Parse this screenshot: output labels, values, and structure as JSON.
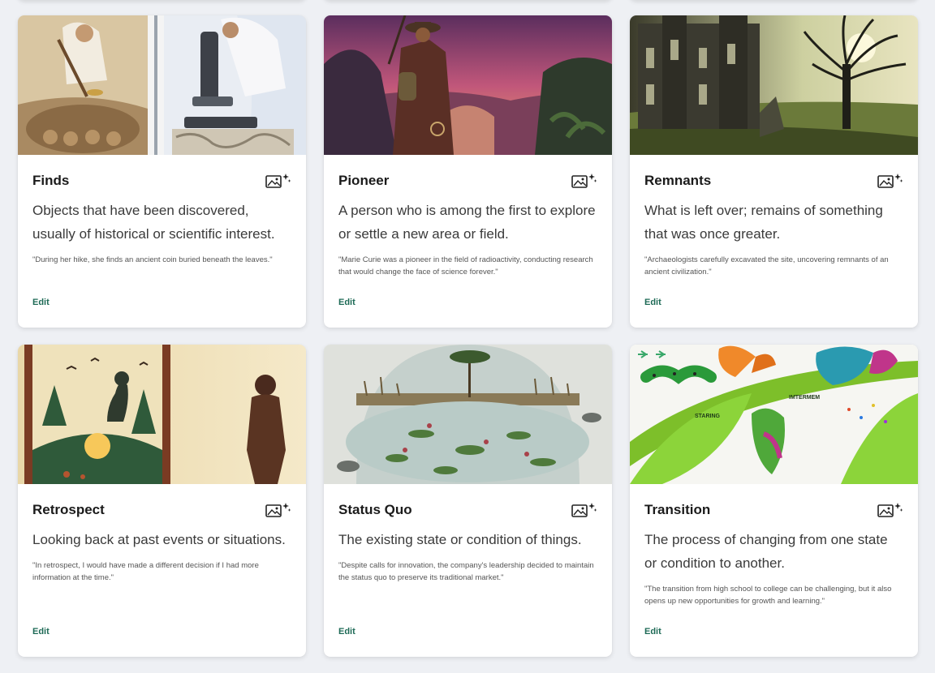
{
  "cards": [
    {
      "word": "Finds",
      "definition": "Objects that have been discovered, usually of historical or scientific interest.",
      "example": "\"During her hike, she finds an ancient coin buried beneath the leaves.\"",
      "edit_label": "Edit",
      "image_label": "archaeologist digging beside scientist at microscope"
    },
    {
      "word": "Pioneer",
      "definition": "A person who is among the first to explore or settle a new area or field.",
      "example": "\"Marie Curie was a pioneer in the field of radioactivity, conducting research that would change the face of science forever.\"",
      "edit_label": "Edit",
      "image_label": "explorer overlooking a jungle valley at sunset"
    },
    {
      "word": "Remnants",
      "definition": "What is left over; remains of something that was once greater.",
      "example": "\"Archaeologists carefully excavated the site, uncovering remnants of an ancient civilization.\"",
      "edit_label": "Edit",
      "image_label": "ruined castle and lone tree at sunrise"
    },
    {
      "word": "Retrospect",
      "definition": "Looking back at past events or situations.",
      "example": "\"In retrospect, I would have made a different decision if I had more information at the time.\"",
      "edit_label": "Edit",
      "image_label": "silhouette of man facing a framed memory scene"
    },
    {
      "word": "Status Quo",
      "definition": "The existing state or condition of things.",
      "example": "\"Despite calls for innovation, the company's leadership decided to maintain the status quo to preserve its traditional market.\"",
      "edit_label": "Edit",
      "image_label": "still pond with lily pads and reflections"
    },
    {
      "word": "Transition",
      "definition": "The process of changing from one state or condition to another.",
      "example": "\"The transition from high school to college can be challenging, but it also opens up new opportunities for growth and learning.\"",
      "edit_label": "Edit",
      "image_label": "caterpillar, chrysalis and butterflies on leaves",
      "image_text": {
        "staring": "STARING",
        "intermem": "IMTERMEM"
      }
    }
  ],
  "colors": {
    "accent": "#1f6b57",
    "background": "#eef0f4"
  },
  "icons": {
    "image_generate": "image-sparkle-icon"
  }
}
